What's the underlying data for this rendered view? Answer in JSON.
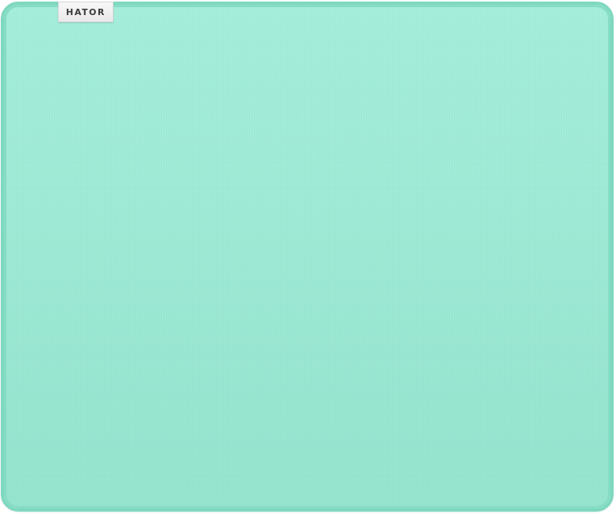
{
  "product": {
    "brand_label": "HATOR",
    "surface_color": "#9be9d4",
    "edge_color": "#7fd8c0",
    "tag_color": "#f2f2f2"
  }
}
